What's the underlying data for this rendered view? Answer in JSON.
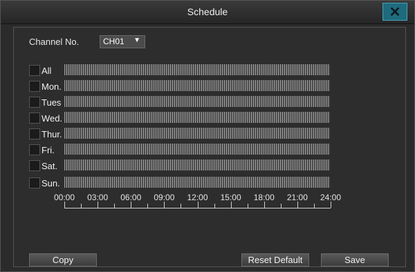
{
  "window": {
    "title": "Schedule"
  },
  "channel": {
    "label": "Channel No.",
    "value": "CH01"
  },
  "days": [
    "All",
    "Mon.",
    "Tues",
    "Wed.",
    "Thur.",
    "Fri.",
    "Sat.",
    "Sun."
  ],
  "axis": {
    "ticks": [
      "00:00",
      "03:00",
      "06:00",
      "09:00",
      "12:00",
      "15:00",
      "18:00",
      "21:00",
      "24:00"
    ]
  },
  "buttons": {
    "copy": "Copy",
    "reset": "Reset Default",
    "save": "Save"
  },
  "colors": {
    "close_accent": "#1f6b7e"
  }
}
